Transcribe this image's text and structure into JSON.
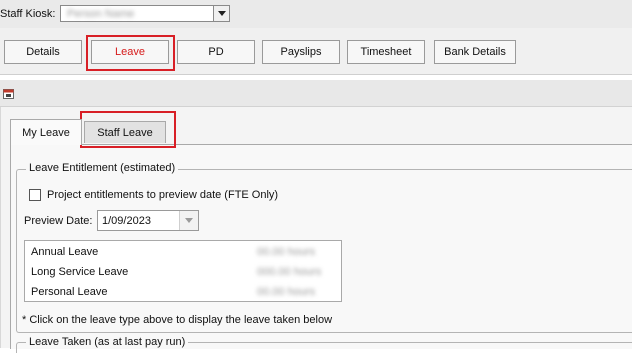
{
  "kiosk": {
    "label": "Staff Kiosk:",
    "selected": "Person Name"
  },
  "nav": {
    "buttons": [
      {
        "label": "Details"
      },
      {
        "label": "Leave"
      },
      {
        "label": "PD"
      },
      {
        "label": "Payslips"
      },
      {
        "label": "Timesheet"
      },
      {
        "label": "Bank Details"
      }
    ],
    "active": "Leave"
  },
  "tabs": {
    "my_leave": "My Leave",
    "staff_leave": "Staff Leave"
  },
  "entitlement": {
    "title": "Leave Entitlement (estimated)",
    "project_checkbox_label": "Project entitlements to preview date (FTE Only)",
    "project_checked": false,
    "preview_date_label": "Preview Date:",
    "preview_date": "1/09/2023",
    "leave_types": [
      {
        "name": "Annual Leave",
        "value": "00.00 hours"
      },
      {
        "name": "Long Service Leave",
        "value": "000.00 hours"
      },
      {
        "name": "Personal Leave",
        "value": "00.00 hours"
      }
    ],
    "footnote": "* Click on the leave type above to display the leave taken below"
  },
  "leave_taken": {
    "title": "Leave Taken (as at last pay run)"
  },
  "colors": {
    "highlight": "#d81f26",
    "active_text": "#d61b1b"
  }
}
